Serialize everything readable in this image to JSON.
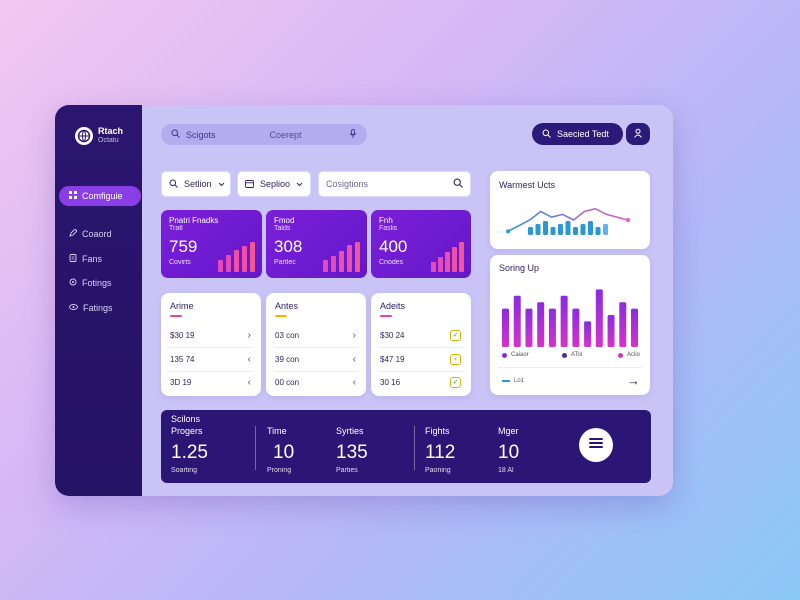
{
  "brand": {
    "name": "Rtach",
    "sub": "Octatu",
    "icon": "globe-icon"
  },
  "sidebar": {
    "items": [
      {
        "label": "Comfiguie",
        "icon": "grid-icon",
        "active": true
      },
      {
        "label": "Coaord",
        "icon": "pen-icon",
        "active": false
      },
      {
        "label": "Fans",
        "icon": "file-icon",
        "active": false
      },
      {
        "label": "Fotings",
        "icon": "gear-icon",
        "active": false
      },
      {
        "label": "Fatings",
        "icon": "eye-icon",
        "active": false
      }
    ]
  },
  "topbar": {
    "search_label": "Scigots",
    "search_placeholder": "Coerept",
    "action_label": "Saecied Tedt",
    "search_icon": "search-icon",
    "mic_icon": "microphone-icon",
    "user_icon": "user-icon"
  },
  "filters": {
    "filter1": "Setlion",
    "filter2": "Seplioo",
    "search_placeholder": "Cosigtions"
  },
  "stats": [
    {
      "line1": "Pnatri Fnadks",
      "line2": "Tratl",
      "value": "759",
      "sub": "Covirts"
    },
    {
      "line1": "Fmod",
      "line2": "Talds",
      "value": "308",
      "sub": "Partlec"
    },
    {
      "line1": "Fnh",
      "line2": "Faslis",
      "value": "400",
      "sub": "Cnodes"
    }
  ],
  "lists": [
    {
      "title": "Arime",
      "rows": [
        "$30 19",
        "135 74",
        "3D 19"
      ],
      "accent": "#e245a8"
    },
    {
      "title": "Antes",
      "rows": [
        "03 con",
        "39 con",
        "00 con"
      ],
      "accent": "#ffb000"
    },
    {
      "title": "Adeits",
      "rows": [
        "$30 24",
        "$47 19",
        "30 16"
      ],
      "accent": "#e245a8"
    }
  ],
  "line_card": {
    "title": "Warmest Ucts"
  },
  "bar_card": {
    "title": "Soring Up",
    "legend": [
      "Caiaor",
      "ATol",
      "Aclio"
    ],
    "footer": "Lo1",
    "arrow_icon": "arrow-right-icon"
  },
  "bottom": {
    "heading": "Scilons",
    "cols": [
      {
        "h": "Progers",
        "v": "1.25",
        "s": "Soarting"
      },
      {
        "h": "Time",
        "v": "10",
        "s": "Proning"
      },
      {
        "h": "Syrties",
        "v": "135",
        "s": "Parties"
      },
      {
        "h": "Fights",
        "v": "112",
        "s": "Paoning"
      },
      {
        "h": "Mger",
        "v": "10",
        "s": "18 Al"
      }
    ],
    "menu_icon": "menu-icon"
  },
  "colors": {
    "accent": "#7b1fd9",
    "sidebar": "#2a1670",
    "bar_purple": "#8a2be2",
    "bar_pink": "#d633c9",
    "line_blue": "#2a97d6"
  },
  "chart_data": [
    {
      "type": "line",
      "series": [
        {
          "values": [
            2,
            4,
            6,
            9,
            7,
            8,
            6,
            9,
            10,
            8,
            7,
            6
          ]
        }
      ]
    },
    {
      "type": "bar",
      "series": [
        {
          "values": [
            6,
            8,
            6,
            7,
            6,
            8,
            6,
            4,
            9,
            5,
            7,
            6
          ]
        }
      ]
    }
  ]
}
